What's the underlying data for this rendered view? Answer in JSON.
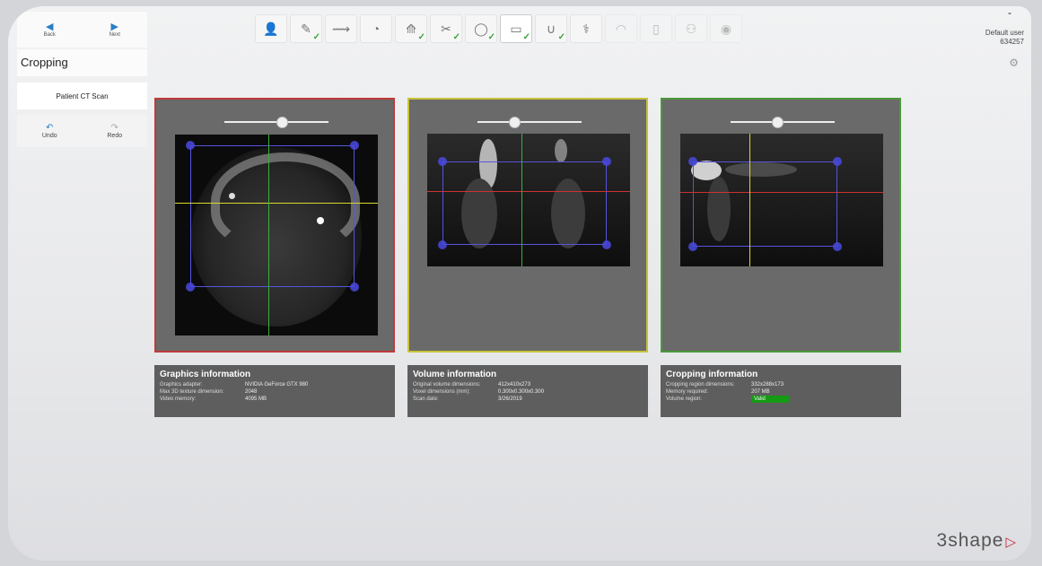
{
  "nav": {
    "back_label": "Back",
    "next_label": "Next"
  },
  "step": {
    "title": "Cropping",
    "patient_scan_label": "Patient CT Scan"
  },
  "edit": {
    "undo_label": "Undo",
    "redo_label": "Redo"
  },
  "toolbar": {
    "steps": [
      {
        "icon": "patient-photo-icon",
        "glyph": "👤",
        "checked": false,
        "active": false,
        "dim": false
      },
      {
        "icon": "prescription-icon",
        "glyph": "✎",
        "checked": true,
        "active": false,
        "dim": false
      },
      {
        "icon": "implant-tool-icon",
        "glyph": "⟿",
        "checked": false,
        "active": false,
        "dim": false
      },
      {
        "icon": "lamp-icon",
        "glyph": "◔",
        "checked": false,
        "active": false,
        "dim": false
      },
      {
        "icon": "scan-import-icon",
        "glyph": "⟰",
        "checked": true,
        "active": false,
        "dim": false
      },
      {
        "icon": "segmentation-icon",
        "glyph": "✂",
        "checked": true,
        "active": false,
        "dim": false
      },
      {
        "icon": "tooth-icon",
        "glyph": "◯",
        "checked": true,
        "active": false,
        "dim": false
      },
      {
        "icon": "crop-volume-icon",
        "glyph": "▭",
        "checked": true,
        "active": true,
        "dim": false
      },
      {
        "icon": "arch-curve-icon",
        "glyph": "∪",
        "checked": true,
        "active": false,
        "dim": false
      },
      {
        "icon": "nerve-icon",
        "glyph": "⚕",
        "checked": false,
        "active": false,
        "dim": false
      },
      {
        "icon": "model-icon",
        "glyph": "◠",
        "checked": false,
        "active": false,
        "dim": true
      },
      {
        "icon": "implant-icon",
        "glyph": "▯",
        "checked": false,
        "active": false,
        "dim": true
      },
      {
        "icon": "people-icon",
        "glyph": "⚇",
        "checked": false,
        "active": false,
        "dim": true
      },
      {
        "icon": "disc-icon",
        "glyph": "◉",
        "checked": false,
        "active": false,
        "dim": true
      }
    ]
  },
  "user": {
    "name": "Default user",
    "id": "634257",
    "minimize": "-"
  },
  "graphics_info": {
    "title": "Graphics information",
    "rows": [
      {
        "k": "Graphics adapter:",
        "v": "NVIDIA GeForce GTX 980"
      },
      {
        "k": "Max 3D texture dimension:",
        "v": "2048"
      },
      {
        "k": "Video memory:",
        "v": "4095 MB"
      }
    ]
  },
  "volume_info": {
    "title": "Volume information",
    "rows": [
      {
        "k": "Original volume dimensions:",
        "v": "412x410x273"
      },
      {
        "k": "Voxel dimensions (mm):",
        "v": "0.300x0.300x0.300"
      },
      {
        "k": "Scan date:",
        "v": "3/26/2019"
      }
    ]
  },
  "cropping_info": {
    "title": "Cropping information",
    "rows": [
      {
        "k": "Cropping region dimensions:",
        "v": "332x288x173"
      },
      {
        "k": "Memory required:",
        "v": "207 MB"
      },
      {
        "k": "Volume region:",
        "v": "Valid"
      }
    ]
  },
  "views": {
    "axial_slider": 0.55,
    "coronal_slider": 0.35,
    "sagittal_slider": 0.45
  },
  "colors": {
    "axial_border": "#c03a3a",
    "coronal_border": "#c8c23a",
    "sagittal_border": "#4a9a3a",
    "valid": "#149a14"
  },
  "brand": {
    "logo": "3shape"
  }
}
